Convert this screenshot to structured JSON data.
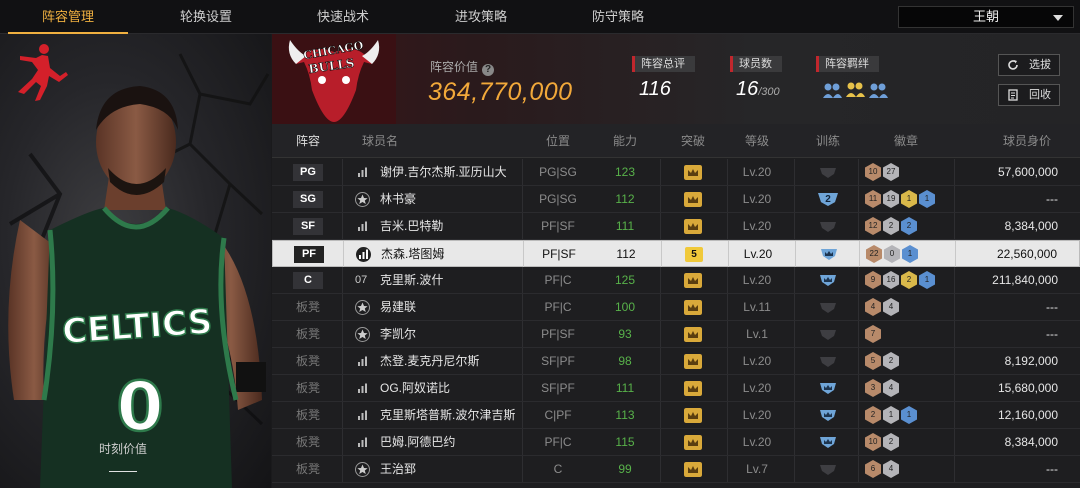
{
  "tabs": [
    "阵容管理",
    "轮换设置",
    "快速战术",
    "进攻策略",
    "防守策略"
  ],
  "team_selector": "王朝",
  "left": {
    "moment_label": "时刻价值",
    "moment_value": "——"
  },
  "header": {
    "value_label": "阵容价值",
    "value": "364,770,000",
    "rating_label": "阵容总评",
    "rating": "116",
    "players_label": "球员数",
    "players": "16",
    "players_max": "/300",
    "chem_label": "阵容羁绊",
    "btn_select": "选拔",
    "btn_recycle": "回收"
  },
  "columns": {
    "lineup": "阵容",
    "name": "球员名",
    "position": "位置",
    "ability": "能力",
    "breakthrough": "突破",
    "level": "等级",
    "training": "训练",
    "badges": "徽章",
    "value": "球员身价"
  },
  "rows": [
    {
      "slot": "PG",
      "bench": false,
      "icon": "bars",
      "name": "谢伊.吉尔杰斯.亚历山大",
      "pos": "PG|SG",
      "ability": "123",
      "brk": "crown",
      "level": "Lv.20",
      "train": "grey",
      "badges": [
        [
          "10",
          "bronze"
        ],
        [
          "27",
          "silver"
        ]
      ],
      "salary": "57,600,000"
    },
    {
      "slot": "SG",
      "bench": false,
      "icon": "star",
      "name": "林书豪",
      "pos": "PG|SG",
      "ability": "112",
      "brk": "crown",
      "level": "Lv.20",
      "train": "2",
      "badges": [
        [
          "11",
          "bronze"
        ],
        [
          "19",
          "silver"
        ],
        [
          "1",
          "gold"
        ],
        [
          "1",
          "blue"
        ]
      ],
      "salary": "---"
    },
    {
      "slot": "SF",
      "bench": false,
      "icon": "bars",
      "name": "吉米.巴特勒",
      "pos": "PF|SF",
      "ability": "111",
      "brk": "crown",
      "level": "Lv.20",
      "train": "grey",
      "badges": [
        [
          "12",
          "bronze"
        ],
        [
          "2",
          "silver"
        ],
        [
          "2",
          "blue"
        ]
      ],
      "salary": "8,384,000"
    },
    {
      "slot": "PF",
      "bench": false,
      "selected": true,
      "icon": "bars",
      "name": "杰森.塔图姆",
      "pos": "PF|SF",
      "ability": "112",
      "brk": "5",
      "level": "Lv.20",
      "train": "blue",
      "badges": [
        [
          "22",
          "bronze"
        ],
        [
          "0",
          "silver"
        ],
        [
          "1",
          "blue"
        ]
      ],
      "salary": "22,560,000"
    },
    {
      "slot": "C",
      "bench": false,
      "icon": "num",
      "icon_text": "07",
      "name": "克里斯.波什",
      "pos": "PF|C",
      "ability": "125",
      "brk": "crown",
      "level": "Lv.20",
      "train": "blue",
      "badges": [
        [
          "9",
          "bronze"
        ],
        [
          "16",
          "silver"
        ],
        [
          "2",
          "gold"
        ],
        [
          "1",
          "blue"
        ]
      ],
      "salary": "211,840,000"
    },
    {
      "slot": "板凳",
      "bench": true,
      "icon": "star",
      "name": "易建联",
      "pos": "PF|C",
      "ability": "100",
      "brk": "crown",
      "level": "Lv.11",
      "train": "grey",
      "badges": [
        [
          "4",
          "bronze"
        ],
        [
          "4",
          "silver"
        ]
      ],
      "salary": "---"
    },
    {
      "slot": "板凳",
      "bench": true,
      "icon": "star",
      "name": "李凯尔",
      "pos": "PF|SF",
      "ability": "93",
      "brk": "crown",
      "level": "Lv.1",
      "train": "grey",
      "badges": [
        [
          "7",
          "bronze"
        ]
      ],
      "salary": "---"
    },
    {
      "slot": "板凳",
      "bench": true,
      "icon": "bars",
      "name": "杰登.麦克丹尼尔斯",
      "pos": "SF|PF",
      "ability": "98",
      "brk": "crown",
      "level": "Lv.20",
      "train": "grey",
      "badges": [
        [
          "5",
          "bronze"
        ],
        [
          "2",
          "silver"
        ]
      ],
      "salary": "8,192,000"
    },
    {
      "slot": "板凳",
      "bench": true,
      "icon": "bars",
      "name": "OG.阿奴诺比",
      "pos": "SF|PF",
      "ability": "111",
      "brk": "crown",
      "level": "Lv.20",
      "train": "blue",
      "badges": [
        [
          "3",
          "bronze"
        ],
        [
          "4",
          "silver"
        ]
      ],
      "salary": "15,680,000"
    },
    {
      "slot": "板凳",
      "bench": true,
      "icon": "bars",
      "name": "克里斯塔普斯.波尔津吉斯",
      "pos": "C|PF",
      "ability": "113",
      "brk": "crown",
      "level": "Lv.20",
      "train": "blue",
      "badges": [
        [
          "2",
          "bronze"
        ],
        [
          "1",
          "silver"
        ],
        [
          "1",
          "blue"
        ]
      ],
      "salary": "12,160,000"
    },
    {
      "slot": "板凳",
      "bench": true,
      "icon": "bars",
      "name": "巴姆.阿德巴约",
      "pos": "PF|C",
      "ability": "115",
      "brk": "crown",
      "level": "Lv.20",
      "train": "blue",
      "badges": [
        [
          "10",
          "bronze"
        ],
        [
          "2",
          "silver"
        ]
      ],
      "salary": "8,384,000"
    },
    {
      "slot": "板凳",
      "bench": true,
      "icon": "star",
      "name": "王治郅",
      "pos": "C",
      "ability": "99",
      "brk": "crown",
      "level": "Lv.7",
      "train": "grey",
      "badges": [
        [
          "6",
          "bronze"
        ],
        [
          "4",
          "silver"
        ]
      ],
      "salary": "---"
    }
  ]
}
